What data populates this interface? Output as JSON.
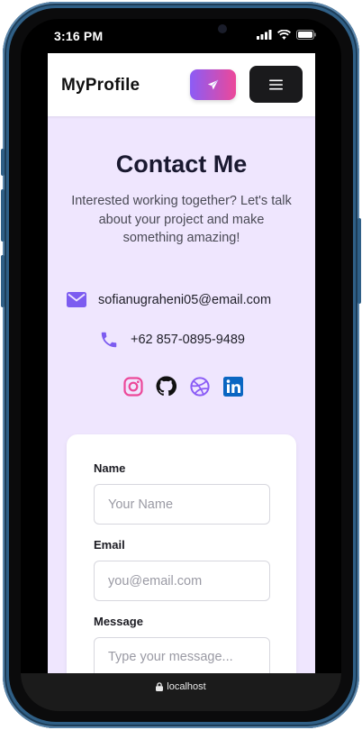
{
  "status_bar": {
    "time": "3:16 PM"
  },
  "navbar": {
    "brand": "MyProfile"
  },
  "contact": {
    "title": "Contact Me",
    "intro": "Interested working together? Let's talk about your project and make something amazing!",
    "email": "sofianugraheni05@email.com",
    "phone": "+62 857-0895-9489"
  },
  "socials": [
    "instagram-icon",
    "github-icon",
    "dribbble-icon",
    "linkedin-icon"
  ],
  "form": {
    "name_label": "Name",
    "name_placeholder": "Your Name",
    "email_label": "Email",
    "email_placeholder": "you@email.com",
    "message_label": "Message",
    "message_placeholder": "Type your message..."
  },
  "browser": {
    "url": "localhost"
  },
  "colors": {
    "accent_purple": "#8b5cf6",
    "accent_pink": "#ec4899",
    "page_bg": "#efe6fe",
    "frame_blue": "#2f5f86"
  }
}
